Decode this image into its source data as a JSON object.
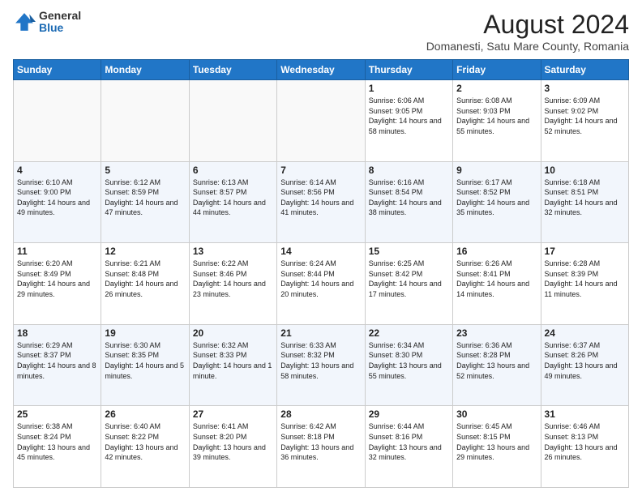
{
  "logo": {
    "general": "General",
    "blue": "Blue"
  },
  "title": "August 2024",
  "subtitle": "Domanesti, Satu Mare County, Romania",
  "days_of_week": [
    "Sunday",
    "Monday",
    "Tuesday",
    "Wednesday",
    "Thursday",
    "Friday",
    "Saturday"
  ],
  "weeks": [
    [
      {
        "day": "",
        "info": ""
      },
      {
        "day": "",
        "info": ""
      },
      {
        "day": "",
        "info": ""
      },
      {
        "day": "",
        "info": ""
      },
      {
        "day": "1",
        "info": "Sunrise: 6:06 AM\nSunset: 9:05 PM\nDaylight: 14 hours and 58 minutes."
      },
      {
        "day": "2",
        "info": "Sunrise: 6:08 AM\nSunset: 9:03 PM\nDaylight: 14 hours and 55 minutes."
      },
      {
        "day": "3",
        "info": "Sunrise: 6:09 AM\nSunset: 9:02 PM\nDaylight: 14 hours and 52 minutes."
      }
    ],
    [
      {
        "day": "4",
        "info": "Sunrise: 6:10 AM\nSunset: 9:00 PM\nDaylight: 14 hours and 49 minutes."
      },
      {
        "day": "5",
        "info": "Sunrise: 6:12 AM\nSunset: 8:59 PM\nDaylight: 14 hours and 47 minutes."
      },
      {
        "day": "6",
        "info": "Sunrise: 6:13 AM\nSunset: 8:57 PM\nDaylight: 14 hours and 44 minutes."
      },
      {
        "day": "7",
        "info": "Sunrise: 6:14 AM\nSunset: 8:56 PM\nDaylight: 14 hours and 41 minutes."
      },
      {
        "day": "8",
        "info": "Sunrise: 6:16 AM\nSunset: 8:54 PM\nDaylight: 14 hours and 38 minutes."
      },
      {
        "day": "9",
        "info": "Sunrise: 6:17 AM\nSunset: 8:52 PM\nDaylight: 14 hours and 35 minutes."
      },
      {
        "day": "10",
        "info": "Sunrise: 6:18 AM\nSunset: 8:51 PM\nDaylight: 14 hours and 32 minutes."
      }
    ],
    [
      {
        "day": "11",
        "info": "Sunrise: 6:20 AM\nSunset: 8:49 PM\nDaylight: 14 hours and 29 minutes."
      },
      {
        "day": "12",
        "info": "Sunrise: 6:21 AM\nSunset: 8:48 PM\nDaylight: 14 hours and 26 minutes."
      },
      {
        "day": "13",
        "info": "Sunrise: 6:22 AM\nSunset: 8:46 PM\nDaylight: 14 hours and 23 minutes."
      },
      {
        "day": "14",
        "info": "Sunrise: 6:24 AM\nSunset: 8:44 PM\nDaylight: 14 hours and 20 minutes."
      },
      {
        "day": "15",
        "info": "Sunrise: 6:25 AM\nSunset: 8:42 PM\nDaylight: 14 hours and 17 minutes."
      },
      {
        "day": "16",
        "info": "Sunrise: 6:26 AM\nSunset: 8:41 PM\nDaylight: 14 hours and 14 minutes."
      },
      {
        "day": "17",
        "info": "Sunrise: 6:28 AM\nSunset: 8:39 PM\nDaylight: 14 hours and 11 minutes."
      }
    ],
    [
      {
        "day": "18",
        "info": "Sunrise: 6:29 AM\nSunset: 8:37 PM\nDaylight: 14 hours and 8 minutes."
      },
      {
        "day": "19",
        "info": "Sunrise: 6:30 AM\nSunset: 8:35 PM\nDaylight: 14 hours and 5 minutes."
      },
      {
        "day": "20",
        "info": "Sunrise: 6:32 AM\nSunset: 8:33 PM\nDaylight: 14 hours and 1 minute."
      },
      {
        "day": "21",
        "info": "Sunrise: 6:33 AM\nSunset: 8:32 PM\nDaylight: 13 hours and 58 minutes."
      },
      {
        "day": "22",
        "info": "Sunrise: 6:34 AM\nSunset: 8:30 PM\nDaylight: 13 hours and 55 minutes."
      },
      {
        "day": "23",
        "info": "Sunrise: 6:36 AM\nSunset: 8:28 PM\nDaylight: 13 hours and 52 minutes."
      },
      {
        "day": "24",
        "info": "Sunrise: 6:37 AM\nSunset: 8:26 PM\nDaylight: 13 hours and 49 minutes."
      }
    ],
    [
      {
        "day": "25",
        "info": "Sunrise: 6:38 AM\nSunset: 8:24 PM\nDaylight: 13 hours and 45 minutes."
      },
      {
        "day": "26",
        "info": "Sunrise: 6:40 AM\nSunset: 8:22 PM\nDaylight: 13 hours and 42 minutes."
      },
      {
        "day": "27",
        "info": "Sunrise: 6:41 AM\nSunset: 8:20 PM\nDaylight: 13 hours and 39 minutes."
      },
      {
        "day": "28",
        "info": "Sunrise: 6:42 AM\nSunset: 8:18 PM\nDaylight: 13 hours and 36 minutes."
      },
      {
        "day": "29",
        "info": "Sunrise: 6:44 AM\nSunset: 8:16 PM\nDaylight: 13 hours and 32 minutes."
      },
      {
        "day": "30",
        "info": "Sunrise: 6:45 AM\nSunset: 8:15 PM\nDaylight: 13 hours and 29 minutes."
      },
      {
        "day": "31",
        "info": "Sunrise: 6:46 AM\nSunset: 8:13 PM\nDaylight: 13 hours and 26 minutes."
      }
    ]
  ]
}
